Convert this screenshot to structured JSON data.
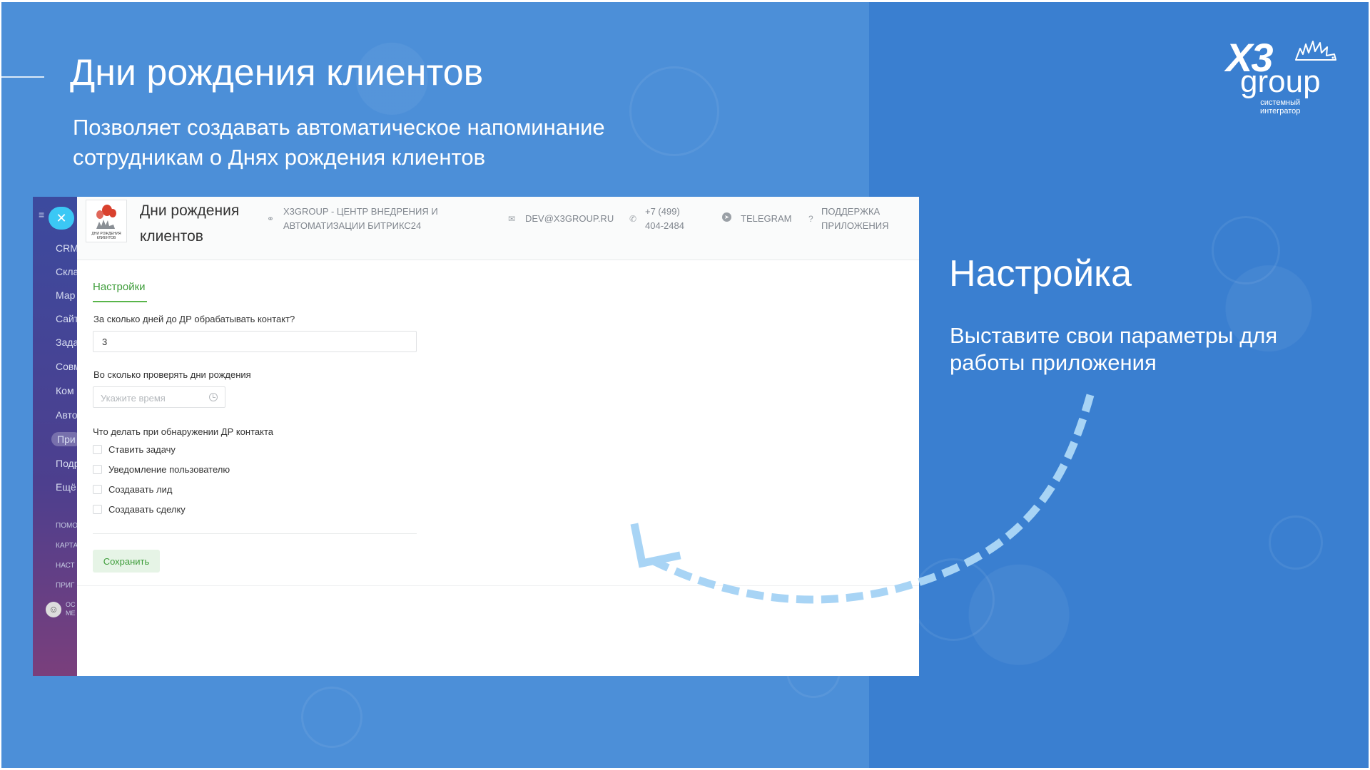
{
  "slide": {
    "title": "Дни рождения клиентов",
    "subtitle": "Позволяет создавать автоматическое напоминание сотрудникам о Днях рождения клиентов"
  },
  "logo": {
    "mark": "X3",
    "wordmark": "group",
    "caption_line1": "системный",
    "caption_line2": "интегратор"
  },
  "sidebar": {
    "items": [
      "CRM",
      "Скла",
      "Мар",
      "Сайт",
      "Зада",
      "Совм",
      "Ком",
      "Авто",
      "При",
      "Подр",
      "Ещё"
    ],
    "active_item": "При",
    "small_items": [
      "ПОМО",
      "КАРТА",
      "НАСТ",
      "ПРИГ"
    ],
    "user_line1": "ОС",
    "user_line2": "МЕ"
  },
  "app": {
    "logo_caption": "ДНИ РОЖДЕНИЯ КЛИЕНТОВ",
    "name_line1": "Дни рождения",
    "name_line2": "клиентов",
    "header_links": {
      "company_line1": "X3GROUP - ЦЕНТР ВНЕДРЕНИЯ И",
      "company_line2": "АВТОМАТИЗАЦИИ БИТРИКС24",
      "email": "DEV@X3GROUP.RU",
      "phone_line1": "+7 (499)",
      "phone_line2": "404-2484",
      "telegram": "TELEGRAM",
      "support_line1": "ПОДДЕРЖКА",
      "support_line2": "ПРИЛОЖЕНИЯ"
    },
    "tab": "Настройки",
    "days_label": "За сколько дней до ДР обрабатывать контакт?",
    "days_value": "3",
    "time_label": "Во сколько проверять дни рождения",
    "time_placeholder": "Укажите время",
    "actions_label": "Что делать при обнаружении ДР контакта",
    "checkboxes": [
      {
        "label": "Ставить задачу",
        "checked": false
      },
      {
        "label": "Уведомление пользователю",
        "checked": false
      },
      {
        "label": "Создавать лид",
        "checked": false
      },
      {
        "label": "Создавать сделку",
        "checked": false
      }
    ],
    "save_label": "Сохранить"
  },
  "right_panel": {
    "title": "Настройка",
    "subtitle": "Выставите свои параметры для работы приложения"
  },
  "colors": {
    "bg_left": "#4c8fd8",
    "bg_right": "#3a7fd0",
    "accent_green": "#3e9d3a",
    "sidebar_top": "#3c4a9e",
    "sidebar_bottom": "#7a3f7c",
    "arrow": "#a8d4f5"
  },
  "icons": {
    "link": "link-icon",
    "email": "envelope-icon",
    "phone": "phone-icon",
    "telegram": "telegram-icon",
    "support": "question-icon",
    "clock": "clock-icon",
    "menu": "menu-icon",
    "close": "close-icon"
  }
}
